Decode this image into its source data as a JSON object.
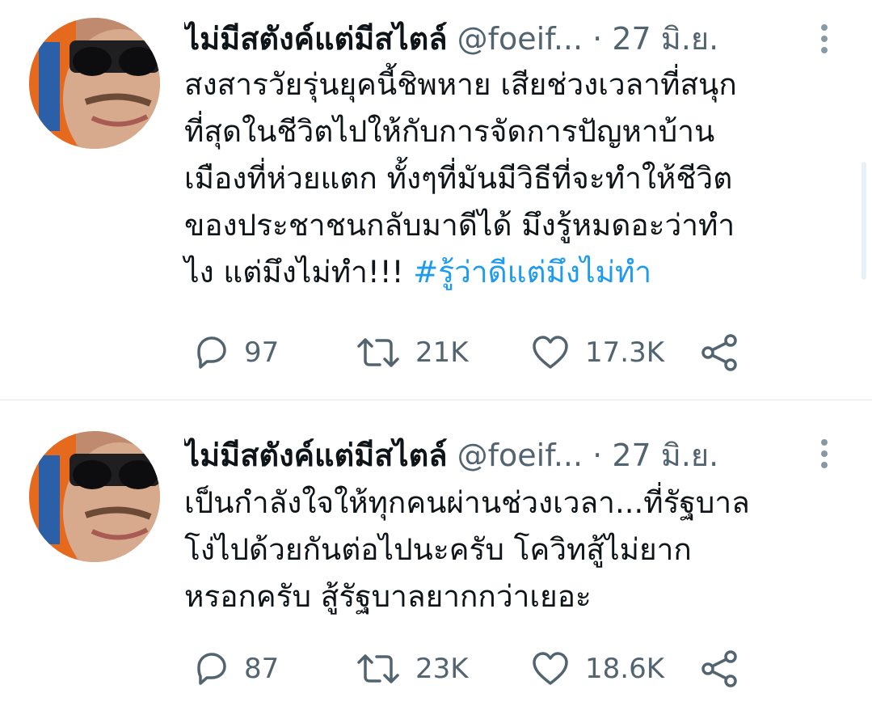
{
  "tweets": [
    {
      "author": {
        "name": "ไม่มีสตังค์แต่มีสไตล์",
        "handle": "@foeif...",
        "separator": "·",
        "date": "27 มิ.ย."
      },
      "text_lines": [
        "สงสารวัยรุ่นยุคนี้ชิพหาย เสียช่วงเวลาที่สนุก",
        "ที่สุดในชีวิตไปให้กับการจัดการปัญหาบ้าน",
        "เมืองที่ห่วยแตก ทั้งๆที่มันมีวิธีที่จะทำให้ชีวิต",
        "ของประชาชนกลับมาดีได้ มึงรู้หมดอะว่าทำ",
        "ไง แต่มึงไม่ทำ!!! "
      ],
      "hashtag": "#รู้ว่าดีแต่มึงไม่ทำ",
      "stats": {
        "replies": "97",
        "retweets": "21K",
        "likes": "17.3K"
      }
    },
    {
      "author": {
        "name": "ไม่มีสตังค์แต่มีสไตล์",
        "handle": "@foeif...",
        "separator": "·",
        "date": "27 มิ.ย."
      },
      "text_lines": [
        "เป็นกำลังใจให้ทุกคนผ่านช่วงเวลา...ที่รัฐบาล",
        "โง่ไปด้วยกันต่อไปนะครับ โควิทสู้ไม่ยาก",
        "หรอกครับ สู้รัฐบาลยากกว่าเยอะ"
      ],
      "stats": {
        "replies": "87",
        "retweets": "23K",
        "likes": "18.6K"
      }
    }
  ],
  "icons": {
    "reply": "reply-icon",
    "retweet": "retweet-icon",
    "like": "like-icon",
    "share": "share-icon",
    "more": "more-options-icon"
  },
  "colors": {
    "text": "#0f1419",
    "secondary": "#536471",
    "hashtag": "#1d9bf0",
    "divider": "#e3e8ec"
  }
}
